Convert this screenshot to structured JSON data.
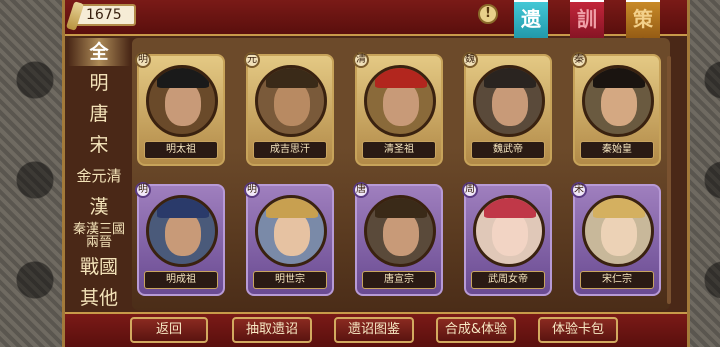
{
  "header": {
    "coins": "1675"
  },
  "banners": [
    "遗",
    "訓",
    "策"
  ],
  "tabs": [
    {
      "label": "全",
      "active": true
    },
    {
      "label": "明"
    },
    {
      "label": "唐"
    },
    {
      "label": "宋"
    },
    {
      "label": "金元清"
    },
    {
      "label": "漢"
    },
    {
      "label": "秦漢三國 兩晉"
    },
    {
      "label": "戰國"
    },
    {
      "label": "其他"
    }
  ],
  "cards": [
    {
      "name": "明太祖",
      "dynasty": "明",
      "frame": "gold"
    },
    {
      "name": "成吉思汗",
      "dynasty": "元",
      "frame": "gold"
    },
    {
      "name": "清圣祖",
      "dynasty": "清",
      "frame": "gold"
    },
    {
      "name": "魏武帝",
      "dynasty": "魏",
      "frame": "gold"
    },
    {
      "name": "秦始皇",
      "dynasty": "秦",
      "frame": "gold"
    },
    {
      "name": "明成祖",
      "dynasty": "明",
      "frame": "purple"
    },
    {
      "name": "明世宗",
      "dynasty": "明",
      "frame": "purple"
    },
    {
      "name": "唐宣宗",
      "dynasty": "唐",
      "frame": "purple"
    },
    {
      "name": "武周女帝",
      "dynasty": "周",
      "frame": "purple"
    },
    {
      "name": "宋仁宗",
      "dynasty": "宋",
      "frame": "purple"
    }
  ],
  "buttons": {
    "back": "返回",
    "draw": "抽取遗诏",
    "catalog": "遗诏图鉴",
    "combine": "合成&体验",
    "trial": "体验卡包"
  },
  "colors": {
    "gold_frame": "#c7a35a",
    "purple_frame": "#8a68b0",
    "bar_red": "#6e1613",
    "teal_banner": "#2ab0c0"
  }
}
